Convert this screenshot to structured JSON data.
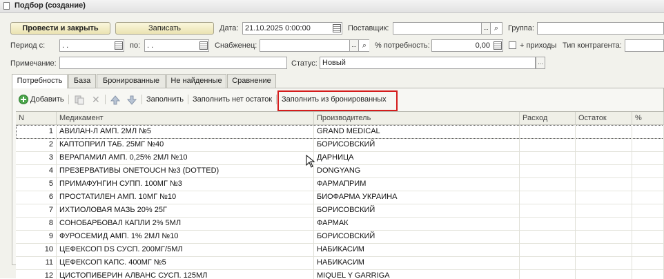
{
  "window": {
    "title": "Подбор (создание)"
  },
  "toolbar": {
    "post_close_label": "Провести и закрыть",
    "save_label": "Записать"
  },
  "header": {
    "date_label": "Дата:",
    "date_value": "21.10.2025  0:00:00",
    "supplier_label": "Поставщик:",
    "supplier_value": "",
    "group_label": "Группа:",
    "period_from_label": "Период с:",
    "period_from_value": "  .  .",
    "period_to_label": "по:",
    "period_to_value": "  .  .",
    "buyer_label": "Снабженец:",
    "buyer_value": "",
    "need_pct_label": "% потребность:",
    "need_pct_value": "0,00",
    "plus_receipts_label": "+ приходы",
    "contractor_type_label": "Тип контрагента:",
    "note_label": "Примечание:",
    "note_value": "",
    "status_label": "Статус:",
    "status_value": "Новый"
  },
  "tabs": [
    {
      "label": "Потребность"
    },
    {
      "label": "База"
    },
    {
      "label": "Бронированные"
    },
    {
      "label": "Не найденные"
    },
    {
      "label": "Сравнение"
    }
  ],
  "table_toolbar": {
    "add_label": "Добавить",
    "fill_label": "Заполнить",
    "fill_no_stock_label": "Заполнить нет остаток",
    "fill_from_reserved_label": "Заполнить из бронированных"
  },
  "table": {
    "columns": [
      "N",
      "Медикамент",
      "Производитель",
      "Расход",
      "Остаток",
      "%"
    ],
    "rows": [
      {
        "n": "1",
        "med": "АВИЛАН-Л АМП. 2МЛ №5",
        "maker": "GRAND MEDICAL"
      },
      {
        "n": "2",
        "med": "КАПТОПРИЛ ТАБ. 25МГ №40",
        "maker": "БОРИСОВСКИЙ"
      },
      {
        "n": "3",
        "med": "ВЕРАПАМИЛ АМП. 0,25% 2МЛ №10",
        "maker": "ДАРНИЦА"
      },
      {
        "n": "4",
        "med": "ПРЕЗЕРВАТИВЫ ONETOUCH №3 (DOTTED)",
        "maker": "DONGYANG"
      },
      {
        "n": "5",
        "med": "ПРИМАФУНГИН СУПП. 100МГ №3",
        "maker": "ФАРМАПРИМ"
      },
      {
        "n": "6",
        "med": "ПРОСТАТИЛЕН АМП. 10МГ №10",
        "maker": "БИОФАРМА УКРАИНА"
      },
      {
        "n": "7",
        "med": "ИХТИОЛОВАЯ МАЗЬ 20% 25Г",
        "maker": "БОРИСОВСКИЙ"
      },
      {
        "n": "8",
        "med": "СОНОБАРБОВАЛ КАПЛИ 2% 5МЛ",
        "maker": "ФАРМАК"
      },
      {
        "n": "9",
        "med": "ФУРОСЕМИД АМП. 1% 2МЛ №10",
        "maker": "БОРИСОВСКИЙ"
      },
      {
        "n": "10",
        "med": "ЦЕФЕКСОП DS СУСП. 200МГ/5МЛ",
        "maker": "НАБИКАСИМ"
      },
      {
        "n": "11",
        "med": "ЦЕФЕКСОП КАПС. 400МГ №5",
        "maker": "НАБИКАСИМ"
      },
      {
        "n": "12",
        "med": "ЦИСТОПИБЕРИН АЛВАНС СУСП. 125МЛ",
        "maker": "MIQUEL Y GARRIGA"
      }
    ]
  },
  "colors": {
    "highlight": "#d41c1c",
    "button_bg": "#f3edc6",
    "form_bg": "#f2f2ec"
  }
}
